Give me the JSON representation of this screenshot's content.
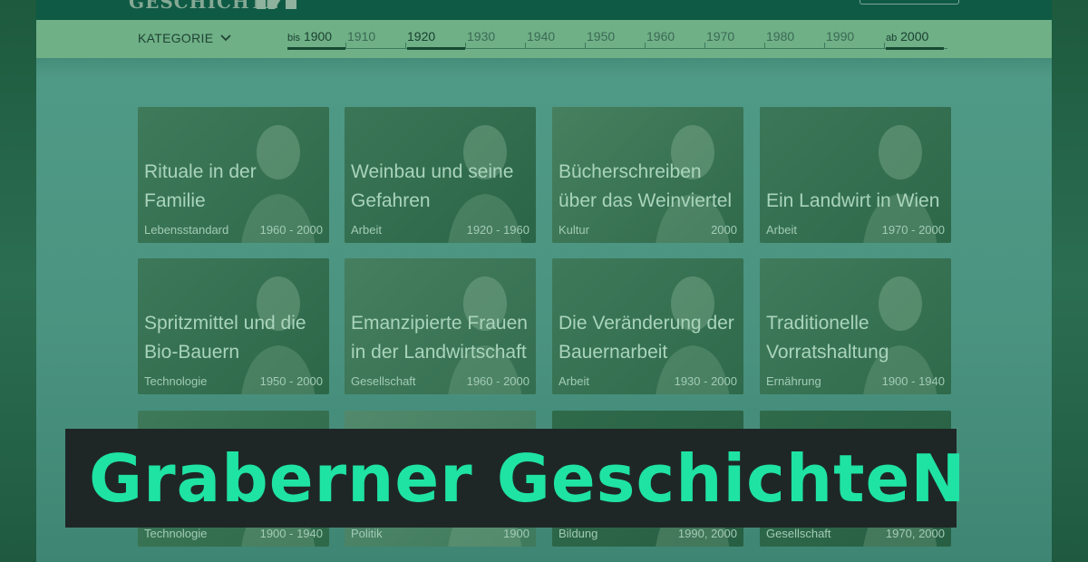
{
  "header": {
    "logo_text": "GESCHICHTE"
  },
  "filter": {
    "category_label": "KATEGORIE",
    "timeline": [
      {
        "prefix": "bis",
        "year": "1900",
        "active": true
      },
      {
        "prefix": "",
        "year": "1910",
        "active": false
      },
      {
        "prefix": "",
        "year": "1920",
        "active": true
      },
      {
        "prefix": "",
        "year": "1930",
        "active": false
      },
      {
        "prefix": "",
        "year": "1940",
        "active": false
      },
      {
        "prefix": "",
        "year": "1950",
        "active": false
      },
      {
        "prefix": "",
        "year": "1960",
        "active": false
      },
      {
        "prefix": "",
        "year": "1970",
        "active": false
      },
      {
        "prefix": "",
        "year": "1980",
        "active": false
      },
      {
        "prefix": "",
        "year": "1990",
        "active": false
      },
      {
        "prefix": "ab",
        "year": "2000",
        "active": true
      }
    ]
  },
  "cards": [
    {
      "title": "Rituale in der Familie",
      "category": "Lebensstandard",
      "years": "1960 - 2000"
    },
    {
      "title": "Weinbau und seine Gefahren",
      "category": "Arbeit",
      "years": "1920 - 1960"
    },
    {
      "title": "Bücherschreiben über das Weinviertel",
      "category": "Kultur",
      "years": "2000"
    },
    {
      "title": "Ein Landwirt in Wien",
      "category": "Arbeit",
      "years": "1970 - 2000"
    },
    {
      "title": "Spritzmittel und die Bio-Bauern",
      "category": "Technologie",
      "years": "1950 - 2000"
    },
    {
      "title": "Emanzipierte Frauen in der Landwirtschaft",
      "category": "Gesellschaft",
      "years": "1960 - 2000"
    },
    {
      "title": "Die Veränderung der Bauernarbeit",
      "category": "Arbeit",
      "years": "1930 - 2000"
    },
    {
      "title": "Traditionelle Vorratshaltung",
      "category": "Ernährung",
      "years": "1900 - 1940"
    },
    {
      "title": "",
      "category": "Technologie",
      "years": "1900 - 1940"
    },
    {
      "title": "",
      "category": "Politik",
      "years": "1900"
    },
    {
      "title": "",
      "category": "Bildung",
      "years": "1990, 2000"
    },
    {
      "title": "",
      "category": "Gesellschaft",
      "years": "1970, 2000"
    }
  ],
  "banner": {
    "text": "Graberner GeschichteN"
  }
}
